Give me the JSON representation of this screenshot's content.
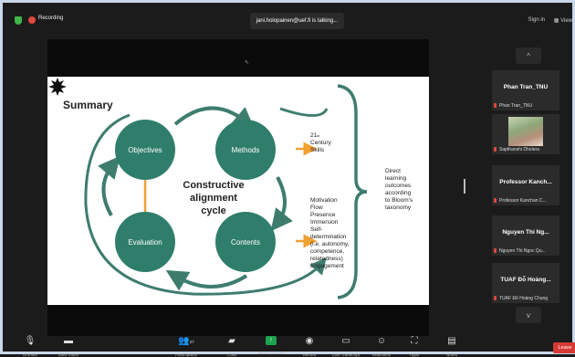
{
  "topbar": {
    "recording_label": "Recording",
    "talking_banner": "jani.holopainen@uef.fi is talking...",
    "sign_in": "Sign in",
    "view": "View"
  },
  "slide": {
    "title": "Summary",
    "circles": {
      "objectives": "Objectives",
      "methods": "Methods",
      "evaluation": "Evaluation",
      "contents": "Contents"
    },
    "center_line1": "Constructive",
    "center_line2": "alignment",
    "center_line3": "cycle",
    "skills_num": "21",
    "skills_sup": "st",
    "skills_line2": "Century",
    "skills_line3": "Skills",
    "motivation_text": "Motivation\nFlow\nPresence\nImmersion\nSelf-\ndetermination\n(i.e. autonomy,\ncompetence,\nrelatedness)\nEngagement",
    "direct_text": "Direct\nlearning\noutcomes\naccording\nto Bloom's\ntaxonomy"
  },
  "sidebar": {
    "up_arrow": "^",
    "down_arrow": "v",
    "tiles": [
      {
        "name": "Phan Tran_TNU",
        "label": "Phan Tran_TNU"
      },
      {
        "name": "",
        "label": "Sapthanshi Dholera"
      },
      {
        "name": "Professor Kanch...",
        "label": "Professor Kanchan C..."
      },
      {
        "name": "Nguyen Thi Ng...",
        "label": "Nguyen Thi Ngoc Qu..."
      },
      {
        "name": "TUAF Đỗ Hoàng...",
        "label": "TUAF Đỗ Hoàng Chung"
      }
    ]
  },
  "toolbar": {
    "unmute": "Unmute",
    "start_video": "Start Video",
    "participants": "Participants",
    "participants_count": "27",
    "chat": "Chat",
    "share_screen": "Share Screen",
    "record": "Record",
    "live_transcript": "Live Transcript",
    "reactions": "Reactions",
    "apps": "Apps",
    "notes": "Notes",
    "leave": "Leave"
  },
  "colors": {
    "circle": "#2f7e6b",
    "arrow": "#3e7d6e",
    "orange_arrow": "#f0a132",
    "share_green": "#1da34e",
    "leave_red": "#d63a33"
  }
}
